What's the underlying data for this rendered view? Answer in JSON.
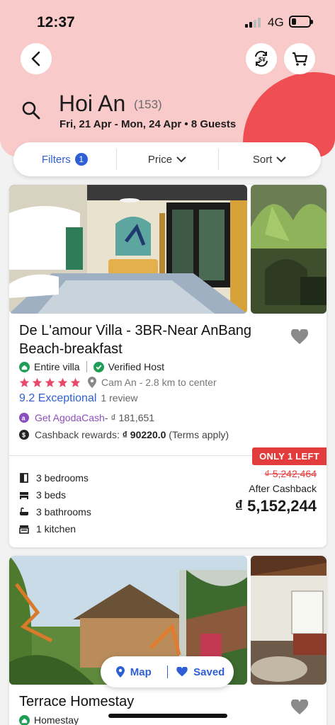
{
  "status": {
    "time": "12:37",
    "network": "4G",
    "battery_level": 0.2
  },
  "header": {
    "city": "Hoi An",
    "count": "(153)",
    "dates": "Fri, 21 Apr - Mon, 24 Apr • 8 Guests"
  },
  "filterbar": {
    "filters": "Filters",
    "filters_count": "1",
    "price": "Price",
    "sort": "Sort"
  },
  "listings": [
    {
      "name": "De L'amour Villa - 3BR-Near AnBang Beach-breakfast",
      "type": "Entire villa",
      "host": "Verified Host",
      "stars": 5,
      "location": "Cam An - 2.8 km to center",
      "score": "9.2 Exceptional",
      "reviews": "1 review",
      "agoda_cash": "Get AgodaCash",
      "agoda_cash_amount": "- ₫ 181,651",
      "rewards_label": "Cashback rewards:",
      "rewards_amount": "₫ 90220.0",
      "rewards_terms": "(Terms apply)",
      "availability": "ONLY 1 LEFT",
      "amenities": [
        "3 bedrooms",
        "3 beds",
        "3 bathrooms",
        "1 kitchen"
      ],
      "old_price": "₫ 5,242,464",
      "after_cashback": "After Cashback",
      "price": "₫ 5,152,244"
    },
    {
      "name": "Terrace Homestay",
      "type": "Homestay"
    }
  ],
  "pill": {
    "map": "Map",
    "saved": "Saved"
  },
  "colors": {
    "header_bg": "#f9caca",
    "accent_blue": "#2f5fd4",
    "red": "#e23c3c",
    "star": "#e8496b",
    "agoda_purple": "#8b4fbd",
    "green": "#1f9d55"
  }
}
